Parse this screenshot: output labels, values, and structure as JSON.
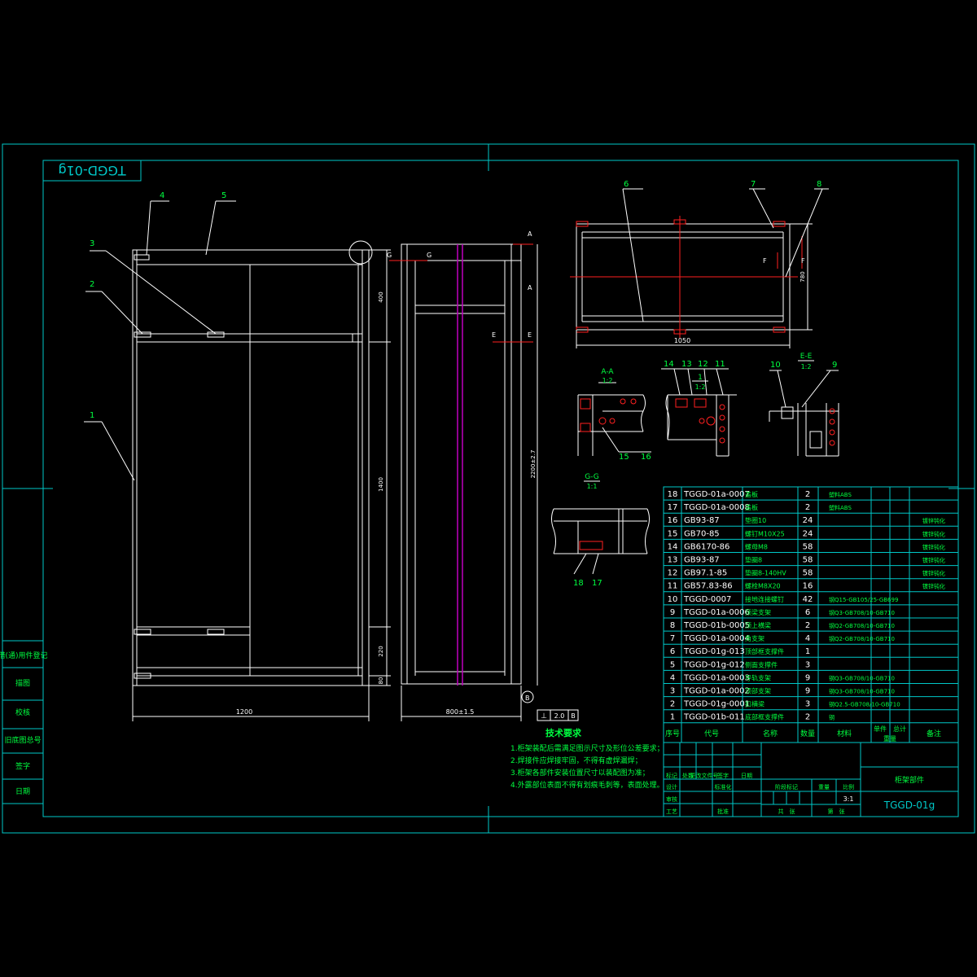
{
  "drawing": {
    "code_stamp": "TGGD-01g",
    "title_code": "TGGD-01g",
    "title_name": "柜架部件",
    "scale": "3:1"
  },
  "balloons": {
    "front": [
      "1",
      "2",
      "3",
      "4",
      "5"
    ],
    "plan": [
      "6",
      "7",
      "8"
    ],
    "detail_top": [
      "14",
      "13",
      "12",
      "11"
    ],
    "detail_a": [
      "15",
      "16"
    ],
    "detail_ee": [
      "10",
      "9"
    ],
    "detail_gg": [
      "18",
      "17"
    ]
  },
  "section_labels": {
    "aa_title": "A-A",
    "aa_scale": "1:2",
    "i_title": "1",
    "i_scale": "1:2",
    "ee_title": "E-E",
    "ee_scale": "1:2",
    "gg_title": "G-G",
    "gg_scale": "1:1",
    "mark_a": "A",
    "mark_e": "E",
    "mark_f": "F",
    "mark_g": "G",
    "mark_b": "B"
  },
  "dimensions": {
    "front_width": "1200",
    "front_h1": "400",
    "front_h2": "1400",
    "front_h3": "220",
    "front_h4": "80",
    "side_width": "800±1.5",
    "side_height": "2200±2.7",
    "plan_width": "1050",
    "plan_depth": "780",
    "flatness_sym": "⊥",
    "flatness_val": "2.0",
    "flatness_datum": "B"
  },
  "tech_requirements": {
    "heading": "技术要求",
    "items": [
      "1.柜架装配后需满足图示尺寸及形位公差要求；",
      "2.焊接件应焊接牢固，不得有虚焊漏焊；",
      "3.柜架各部件安装位置尺寸以装配图为准；",
      "4.外露部位表面不得有划痕毛刺等，表面处理。"
    ]
  },
  "side_panel": {
    "cells": [
      "借(通)用件登记",
      "旧底图总号",
      "底图总号",
      "签字",
      "日期",
      "描图",
      "校核"
    ]
  },
  "bom": {
    "header": {
      "no": "序号",
      "code": "代号",
      "name": "名称",
      "qty": "数量",
      "material": "材料",
      "unit_w": "单件",
      "total_w": "总计",
      "weight": "重量",
      "note": "备注"
    },
    "rows": [
      {
        "no": "18",
        "code": "TGGD-01a-0007",
        "name": "盖板",
        "qty": "2",
        "material": "塑料ABS",
        "note": ""
      },
      {
        "no": "17",
        "code": "TGGD-01a-0008",
        "name": "盖板",
        "qty": "2",
        "material": "塑料ABS",
        "note": ""
      },
      {
        "no": "16",
        "code": "GB93-87",
        "name": "垫圈10",
        "qty": "24",
        "material": "",
        "note": "镀锌钝化"
      },
      {
        "no": "15",
        "code": "GB70-85",
        "name": "螺钉M10X25",
        "qty": "24",
        "material": "",
        "note": "镀锌钝化"
      },
      {
        "no": "14",
        "code": "GB6170-86",
        "name": "螺母M8",
        "qty": "58",
        "material": "",
        "note": "镀锌钝化"
      },
      {
        "no": "13",
        "code": "GB93-87",
        "name": "垫圈8",
        "qty": "58",
        "material": "",
        "note": "镀锌钝化"
      },
      {
        "no": "12",
        "code": "GB97.1-85",
        "name": "垫圈8-140HV",
        "qty": "58",
        "material": "",
        "note": "镀锌钝化"
      },
      {
        "no": "11",
        "code": "GB57.83-86",
        "name": "螺栓M8X20",
        "qty": "16",
        "material": "",
        "note": "镀锌钝化"
      },
      {
        "no": "10",
        "code": "TGGD-0007",
        "name": "接地连接螺钉",
        "qty": "42",
        "material": "钢Q15-GB105/25-GB699",
        "note": ""
      },
      {
        "no": "9",
        "code": "TGGD-01a-0006",
        "name": "顶梁支架",
        "qty": "6",
        "material": "钢Q3-GB708/10-GB710",
        "note": ""
      },
      {
        "no": "8",
        "code": "TGGD-01b-0005",
        "name": "顶上横梁",
        "qty": "2",
        "material": "钢Q2-GB708/10-GB710",
        "note": ""
      },
      {
        "no": "7",
        "code": "TGGD-01a-0004",
        "name": "角支架",
        "qty": "4",
        "material": "钢Q2-GB708/10-GB710",
        "note": ""
      },
      {
        "no": "6",
        "code": "TGGD-01g-013",
        "name": "顶部框支撑件",
        "qty": "1",
        "material": "",
        "note": ""
      },
      {
        "no": "5",
        "code": "TGGD-01g-012",
        "name": "侧面支撑件",
        "qty": "3",
        "material": "",
        "note": ""
      },
      {
        "no": "4",
        "code": "TGGD-01a-0003",
        "name": "导轨支架",
        "qty": "9",
        "material": "钢Q3-GB708/10-GB710",
        "note": ""
      },
      {
        "no": "3",
        "code": "TGGD-01a-0002",
        "name": "顶部支架",
        "qty": "9",
        "material": "钢Q3-GB708/10-GB710",
        "note": ""
      },
      {
        "no": "2",
        "code": "TGGD-01g-0001",
        "name": "扣横梁",
        "qty": "3",
        "material": "钢Q2.5-GB708/10-GB710",
        "note": ""
      },
      {
        "no": "1",
        "code": "TGGD-01b-011",
        "name": "底部框支撑件",
        "qty": "2",
        "material": "钢",
        "note": ""
      }
    ]
  },
  "title_block": {
    "mark": "标记",
    "count": "处数",
    "change_doc": "更改文件号",
    "sign": "签字",
    "date": "日期",
    "design": "设计",
    "std": "标准化",
    "check": "审核",
    "craft": "工艺",
    "approve": "批准",
    "stage": "阶段标记",
    "weight": "重量",
    "ratio": "比例",
    "sheets": "共　张",
    "sheet": "第　张"
  },
  "colors": {
    "frame": "#00c8c8",
    "geometry": "#ffffff",
    "text": "#00ff40",
    "red": "#ff2020",
    "magenta": "#c000c0",
    "yellow": "#ffff00"
  }
}
